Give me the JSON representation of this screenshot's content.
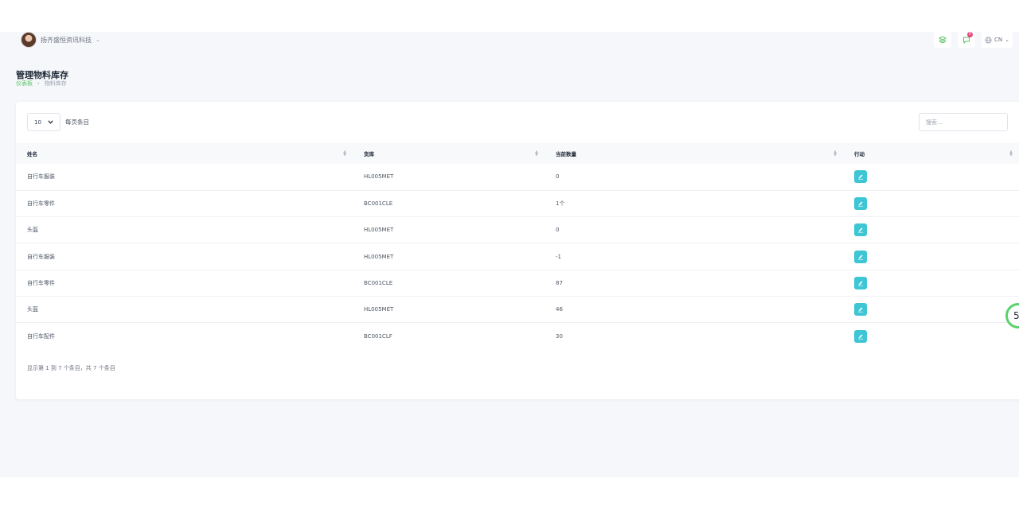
{
  "colors": {
    "accent": "#5bc36b",
    "action": "#3ec6d4",
    "notification": "#e8457a"
  },
  "header": {
    "company_name": "扬齐盛恒资讯科技",
    "notification_count": "0",
    "language": "CN"
  },
  "page": {
    "title": "管理物料库存",
    "breadcrumb": [
      "仪表板",
      "物料库存"
    ]
  },
  "table_controls": {
    "page_length": "10",
    "page_length_label": "每页条目",
    "search_placeholder": "搜索..."
  },
  "table": {
    "columns": [
      "姓名",
      "货库",
      "当前数量",
      "行动"
    ],
    "rows": [
      {
        "name": "自行车服装",
        "code": "HL005MET",
        "qty": "0"
      },
      {
        "name": "自行车零件",
        "code": "BC001CLE",
        "qty": "1个"
      },
      {
        "name": "头盔",
        "code": "HL005MET",
        "qty": "0"
      },
      {
        "name": "自行车服装",
        "code": "HL005MET",
        "qty": "-1"
      },
      {
        "name": "自行车零件",
        "code": "BC001CLE",
        "qty": "87"
      },
      {
        "name": "头盔",
        "code": "HL005MET",
        "qty": "46"
      },
      {
        "name": "自行车配件",
        "code": "BC001CLF",
        "qty": "30"
      }
    ],
    "info": "显示第 1 到 7 个条目，共 7 个条目"
  },
  "floating_badge": "5",
  "icons": {
    "stack": "layers-icon",
    "chat": "chat-icon",
    "globe": "globe-icon",
    "edit": "edit-icon"
  }
}
